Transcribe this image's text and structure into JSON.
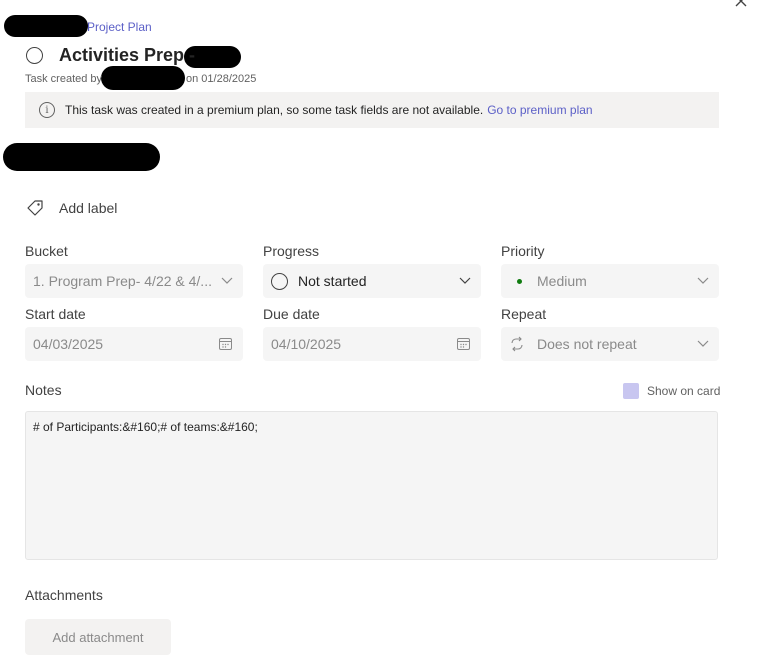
{
  "header": {
    "plan_name": "Project Plan",
    "task_title": "Activities Prep -",
    "created_prefix": "Task created by",
    "created_suffix": "on 01/28/2025"
  },
  "banner": {
    "text": "This task was created in a premium plan, so some task fields are not available.",
    "link": "Go to premium plan"
  },
  "labels": {
    "add_label": "Add label"
  },
  "fields": {
    "bucket": {
      "label": "Bucket",
      "value": "1. Program Prep- 4/22 & 4/..."
    },
    "progress": {
      "label": "Progress",
      "value": "Not started"
    },
    "priority": {
      "label": "Priority",
      "value": "Medium",
      "color": "#107c10"
    },
    "start_date": {
      "label": "Start date",
      "value": "04/03/2025"
    },
    "due_date": {
      "label": "Due date",
      "value": "04/10/2025"
    },
    "repeat": {
      "label": "Repeat",
      "value": "Does not repeat"
    }
  },
  "notes": {
    "label": "Notes",
    "show_on_card": "Show on card",
    "value": "# of Participants:&#160;# of teams:&#160;"
  },
  "attachments": {
    "label": "Attachments",
    "add_button": "Add attachment"
  },
  "colors": {
    "accent": "#5b5fc7",
    "banner_bg": "#f3f2f1",
    "field_bg": "#f5f5f5"
  },
  "icons": {
    "close": "close-icon",
    "info": "info-icon",
    "tag": "tag-icon",
    "chevron": "chevron-down-icon",
    "calendar": "calendar-icon",
    "repeat": "repeat-icon"
  }
}
